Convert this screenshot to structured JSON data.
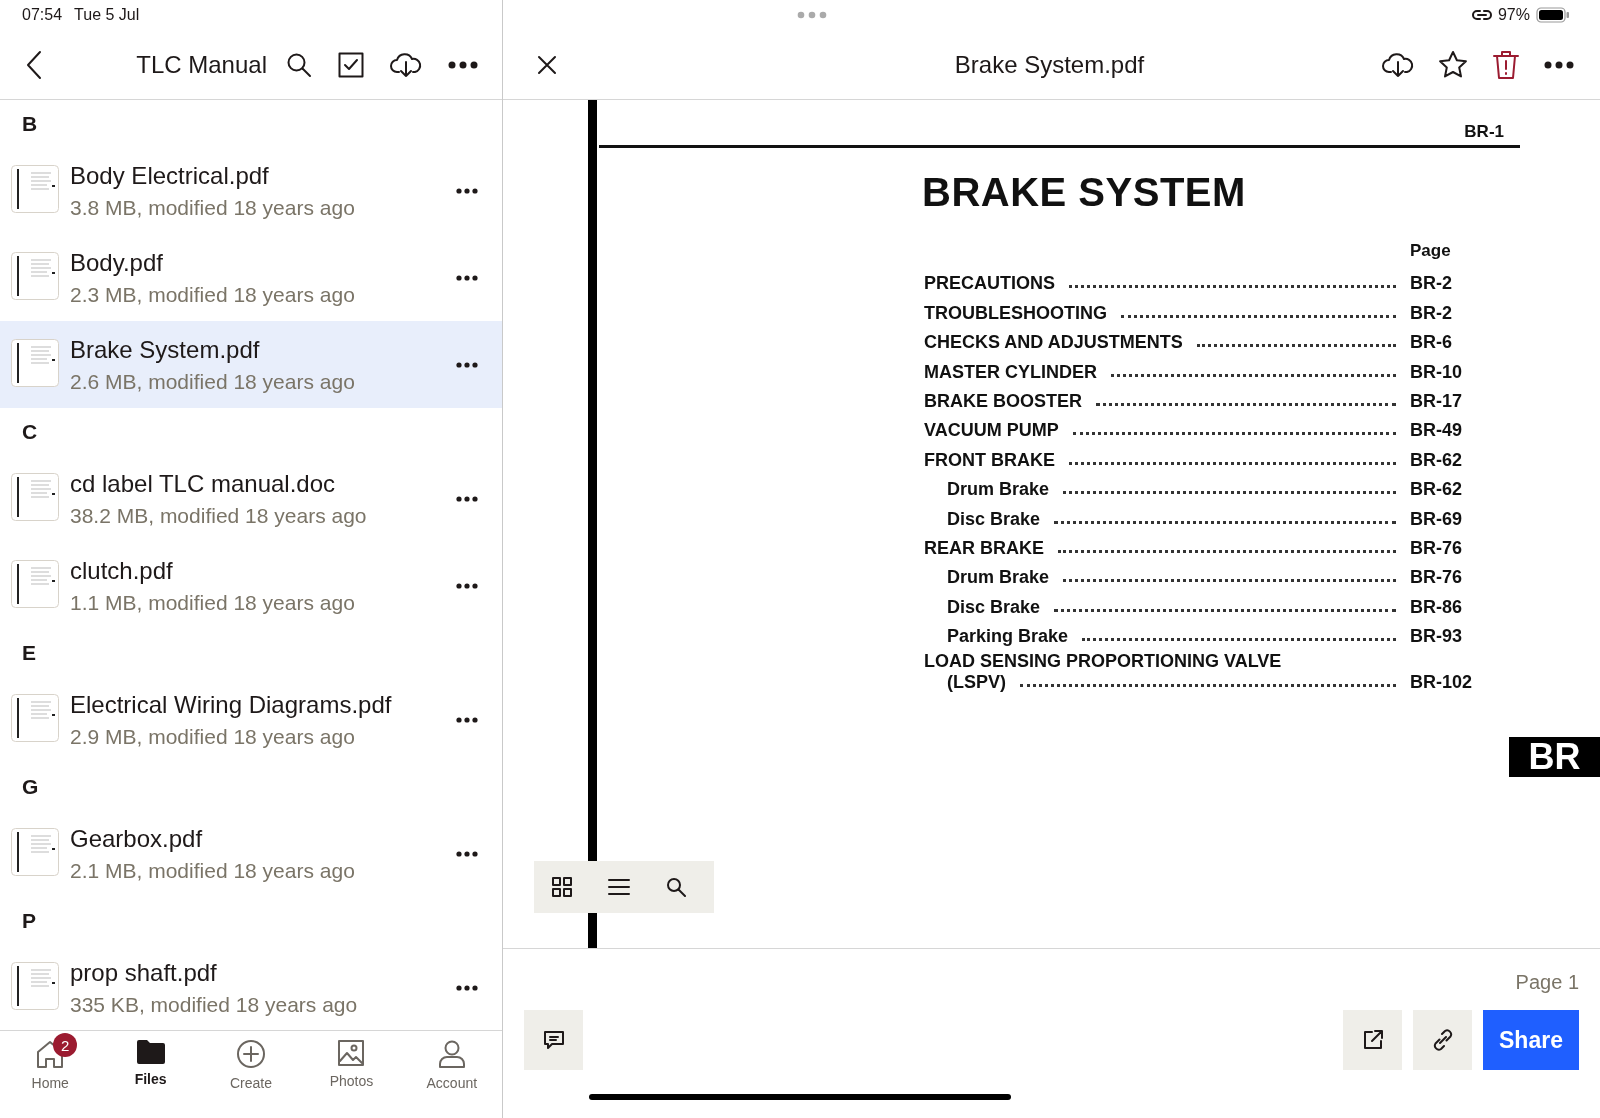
{
  "status_bar": {
    "time": "07:54",
    "date": "Tue 5 Jul",
    "battery": "97%"
  },
  "browser": {
    "title": "TLC Manual",
    "sections": [
      {
        "letter": "B",
        "files": [
          {
            "name": "Body Electrical.pdf",
            "meta": "3.8 MB, modified 18 years ago",
            "selected": false
          },
          {
            "name": "Body.pdf",
            "meta": "2.3 MB, modified 18 years ago",
            "selected": false
          },
          {
            "name": "Brake System.pdf",
            "meta": "2.6 MB, modified 18 years ago",
            "selected": true
          }
        ]
      },
      {
        "letter": "C",
        "files": [
          {
            "name": "cd label TLC manual.doc",
            "meta": "38.2 MB, modified 18 years ago",
            "selected": false
          },
          {
            "name": "clutch.pdf",
            "meta": "1.1 MB, modified 18 years ago",
            "selected": false
          }
        ]
      },
      {
        "letter": "E",
        "files": [
          {
            "name": "Electrical Wiring Diagrams.pdf",
            "meta": "2.9 MB, modified 18 years ago",
            "selected": false
          }
        ]
      },
      {
        "letter": "G",
        "files": [
          {
            "name": "Gearbox.pdf",
            "meta": "2.1 MB, modified 18 years ago",
            "selected": false
          }
        ]
      },
      {
        "letter": "P",
        "files": [
          {
            "name": "prop shaft.pdf",
            "meta": "335 KB, modified 18 years ago",
            "selected": false
          }
        ]
      }
    ],
    "tab_bar": [
      {
        "kind": "home",
        "label": "Home",
        "badge": "2",
        "selected": false
      },
      {
        "kind": "files",
        "label": "Files",
        "selected": true
      },
      {
        "kind": "create",
        "label": "Create",
        "selected": false
      },
      {
        "kind": "photos",
        "label": "Photos",
        "selected": false
      },
      {
        "kind": "account",
        "label": "Account",
        "selected": false
      }
    ]
  },
  "viewer": {
    "title": "Brake System.pdf",
    "document": {
      "page_code": "BR-1",
      "heading": "BRAKE SYSTEM",
      "page_column": "Page",
      "toc": [
        {
          "title": "PRECAUTIONS",
          "page": "BR-2"
        },
        {
          "title": "TROUBLESHOOTING",
          "page": "BR-2"
        },
        {
          "title": "CHECKS AND ADJUSTMENTS",
          "page": "BR-6"
        },
        {
          "title": "MASTER CYLINDER",
          "page": "BR-10"
        },
        {
          "title": "BRAKE BOOSTER",
          "page": "BR-17"
        },
        {
          "title": "VACUUM PUMP",
          "page": "BR-49"
        },
        {
          "title": "FRONT BRAKE",
          "page": "BR-62",
          "children": [
            {
              "title": "Drum Brake",
              "page": "BR-62"
            },
            {
              "title": "Disc Brake",
              "page": "BR-69"
            }
          ]
        },
        {
          "title": "REAR BRAKE",
          "page": "BR-76",
          "children": [
            {
              "title": "Drum Brake",
              "page": "BR-76"
            },
            {
              "title": "Disc Brake",
              "page": "BR-86"
            },
            {
              "title": "Parking Brake",
              "page": "BR-93"
            }
          ]
        },
        {
          "title": "LOAD SENSING PROPORTIONING VALVE",
          "title_continued": "(LSPV)",
          "page": "BR-102"
        }
      ],
      "section_tab": "BR"
    },
    "page_indicator": "Page 1",
    "share_button": "Share"
  }
}
